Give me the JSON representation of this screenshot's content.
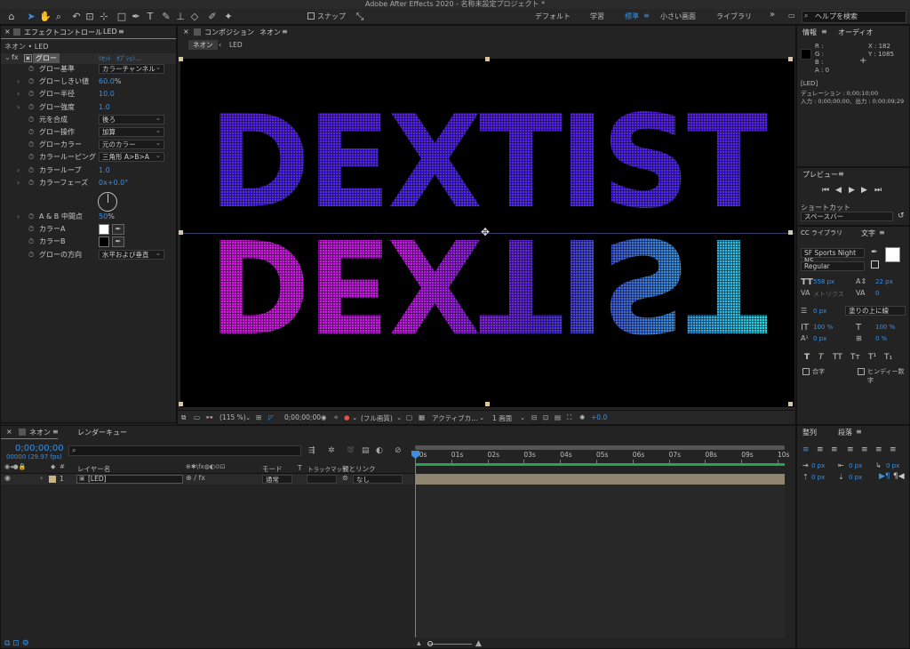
{
  "app": {
    "title": "Adobe After Effects 2020 - 名称未設定プロジェクト *"
  },
  "toolbar": {
    "snap_label": "スナップ",
    "workspaces": [
      "デフォルト",
      "学習",
      "標準",
      "小さい画面",
      "ライブラリ"
    ],
    "active_workspace": "標準",
    "more": "»",
    "help_placeholder": "ヘルプを検索"
  },
  "effects_panel": {
    "tab": "エフェクトコントロール",
    "tab_layer": "LED",
    "layer_path": "ネオン • LED",
    "effect_name": "グロー",
    "reset": "ﾘｾｯﾄ",
    "options": "ｵﾌﾟｼｮﾝ...",
    "props": [
      {
        "label": "グロー基準",
        "type": "dropdown",
        "value": "カラーチャンネル",
        "arrow": false
      },
      {
        "label": "グローしきい値",
        "type": "value",
        "value": "60.0",
        "unit": "%",
        "arrow": true
      },
      {
        "label": "グロー半径",
        "type": "value",
        "value": "10.0",
        "arrow": true
      },
      {
        "label": "グロー強度",
        "type": "value",
        "value": "1.0",
        "arrow": true
      },
      {
        "label": "元を合成",
        "type": "dropdown",
        "value": "後ろ",
        "arrow": false
      },
      {
        "label": "グロー操作",
        "type": "dropdown",
        "value": "加算",
        "arrow": false
      },
      {
        "label": "グローカラー",
        "type": "dropdown",
        "value": "元のカラー",
        "arrow": false
      },
      {
        "label": "カラールーピング",
        "type": "dropdown",
        "value": "三角形 A>B>A",
        "arrow": false
      },
      {
        "label": "カラーループ",
        "type": "value",
        "value": "1.0",
        "arrow": true
      },
      {
        "label": "カラーフェーズ",
        "type": "value",
        "value": "0x+0.0°",
        "arrow": true
      },
      {
        "label": "A & B 中間点",
        "type": "value",
        "value": "50",
        "unit": "%",
        "arrow": true
      },
      {
        "label": "カラーA",
        "type": "swatch",
        "value": "#ffffff",
        "arrow": false
      },
      {
        "label": "カラーB",
        "type": "swatch",
        "value": "#000000",
        "arrow": false
      },
      {
        "label": "グローの方向",
        "type": "dropdown",
        "value": "水平および垂直",
        "arrow": false
      }
    ]
  },
  "comp_panel": {
    "tab": "コンポジション",
    "tab_comp": "ネオン",
    "breadcrumb_comp": "ネオン",
    "breadcrumb_layer": "LED",
    "neon_text": "DEXTIST",
    "viewer": {
      "zoom": "(115 %)",
      "timecode": "0;00;00;00",
      "quality": "(フル画質)",
      "camera": "アクティブカ...",
      "views": "1 画面",
      "exposure": "+0.0"
    }
  },
  "info_panel": {
    "tab": "情報",
    "tab2": "オーディオ",
    "r": "R :",
    "g": "G :",
    "b": "B :",
    "a": "A :  0",
    "x": "X : 182",
    "y": "Y : 1085",
    "layer": "[LED]",
    "duration": "デュレーション : 0;00;10;00",
    "inout": "入力 : 0;00;00;00、出力 : 0;00;09;29"
  },
  "preview_panel": {
    "tab": "プレビュー",
    "shortcut_label": "ショートカット",
    "shortcut_value": "スペースバー"
  },
  "text_panel": {
    "tab_lib": "CC ライブラリ",
    "tab": "文字",
    "font": "SF Sports Night NS ...",
    "style": "Regular",
    "size": "558 px",
    "leading": "22 px",
    "kerning": "メトリクス",
    "tracking": "0",
    "stroke_width": "0 px",
    "stroke_type": "塗りの上に線",
    "vscale": "100 %",
    "hscale": "100 %",
    "baseline": "0 px",
    "tsume": "0 %",
    "styles": [
      "T",
      "T",
      "TT",
      "Tт",
      "T¹",
      "T₁"
    ],
    "ligature": "合字",
    "hindi": "ヒンディー数字"
  },
  "timeline": {
    "tab": "ネオン",
    "render_queue": "レンダーキュー",
    "timecode": "0;00;00;00",
    "fps": "00000 (29.97 fps)",
    "col_layer": "レイヤー名",
    "col_mode": "モード",
    "col_t": "T",
    "col_trackmatte": "トラックマット",
    "col_parent": "親とリンク",
    "ruler": [
      "00s",
      "01s",
      "02s",
      "03s",
      "04s",
      "05s",
      "06s",
      "07s",
      "08s",
      "09s",
      "10s"
    ],
    "layer": {
      "num": "1",
      "name": "[LED]",
      "mode": "通常",
      "parent": "なし"
    }
  },
  "align_panel": {
    "tab": "整列",
    "tab2": "段落",
    "indent_vals": [
      "0 px",
      "0 px",
      "0 px",
      "0 px",
      "0 px"
    ]
  }
}
